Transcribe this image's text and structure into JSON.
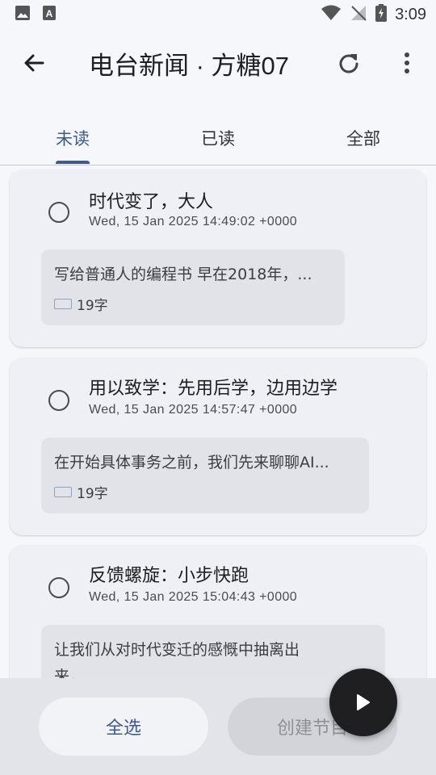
{
  "status_bar": {
    "time": "3:09"
  },
  "app_bar": {
    "title": "电台新闻 · 方糖07"
  },
  "tabs": [
    {
      "label": "未读",
      "active": true
    },
    {
      "label": "已读",
      "active": false
    },
    {
      "label": "全部",
      "active": false
    }
  ],
  "items": [
    {
      "title": "时代变了，大人",
      "date": "Wed, 15 Jan 2025 14:49:02 +0000",
      "snippet": "写给普通人的编程书 早在2018年，...",
      "char_count": "19字"
    },
    {
      "title": "用以致学：先用后学，边用边学",
      "date": "Wed, 15 Jan 2025 14:57:47 +0000",
      "snippet": "在开始具体事务之前，我们先来聊聊AI...",
      "char_count": "19字"
    },
    {
      "title": "反馈螺旋：小步快跑",
      "date": "Wed, 15 Jan 2025 15:04:43 +0000",
      "snippet_line1": "让我们从对时代变迁的感慨中抽离出",
      "snippet_line2": "来，"
    }
  ],
  "bottom": {
    "select_all_label": "全选",
    "create_label": "创建节目"
  },
  "colors": {
    "accent": "#3d5b8f",
    "fab": "#1f1f22"
  }
}
